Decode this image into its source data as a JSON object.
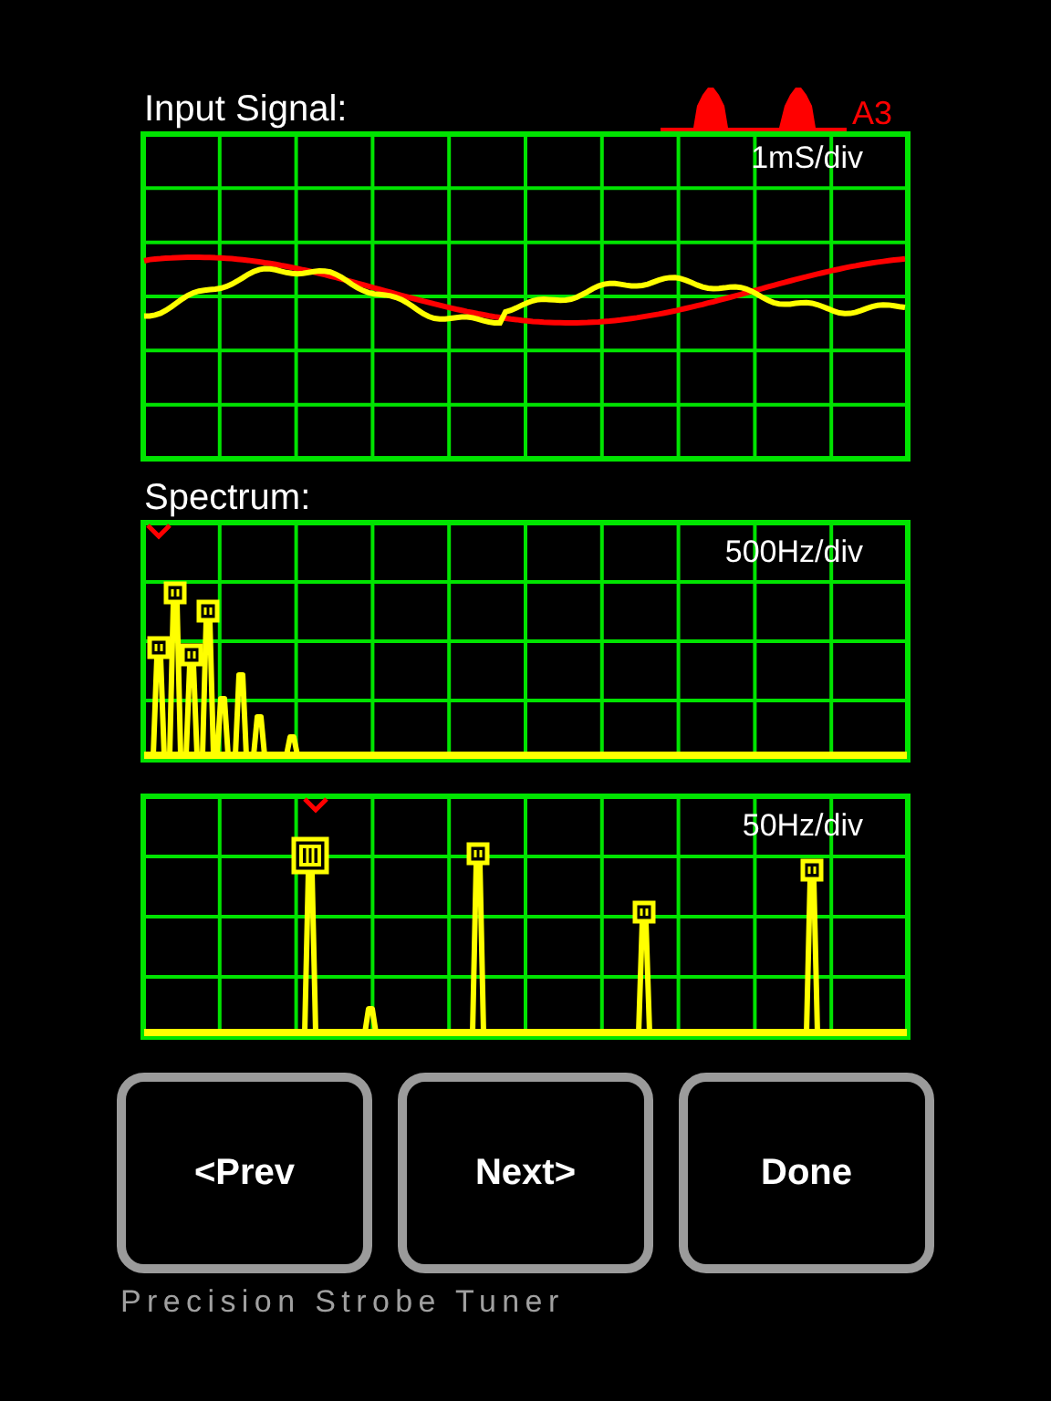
{
  "note": {
    "label": "A3"
  },
  "panels": [
    {
      "title": "Input Signal:",
      "kind": "waveform",
      "scale": "1mS/div"
    },
    {
      "title": "Spectrum:",
      "kind": "spectrum_wide",
      "scale": "500Hz/div"
    },
    {
      "kind": "spectrum_narrow",
      "scale": "50Hz/div"
    }
  ],
  "buttons": [
    "<Prev",
    "Next>",
    "Done"
  ],
  "footer": "Precision Strobe Tuner"
}
